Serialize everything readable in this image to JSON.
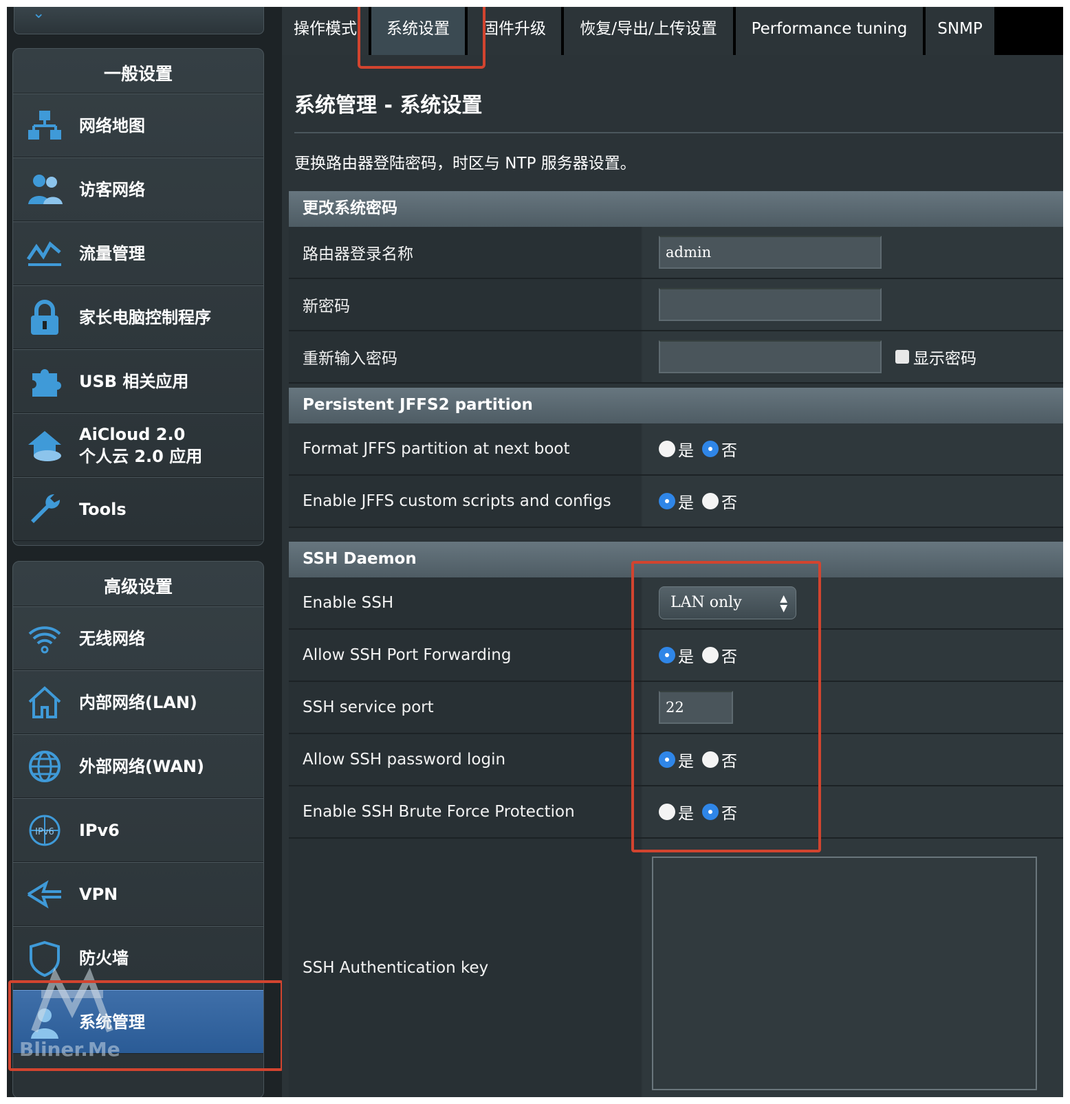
{
  "tabs": [
    {
      "label": "操作模式"
    },
    {
      "label": "系统设置"
    },
    {
      "label": "固件升级"
    },
    {
      "label": "恢复/导出/上传设置"
    },
    {
      "label": "Performance tuning"
    },
    {
      "label": "SNMP"
    }
  ],
  "sidebar": {
    "general_title": "一般设置",
    "general_items": [
      {
        "label": "网络地图",
        "icon": "network-map-icon"
      },
      {
        "label": "访客网络",
        "icon": "guest-network-icon"
      },
      {
        "label": "流量管理",
        "icon": "traffic-manager-icon"
      },
      {
        "label": "家长电脑控制程序",
        "icon": "parental-lock-icon"
      },
      {
        "label": "USB 相关应用",
        "icon": "usb-puzzle-icon"
      },
      {
        "label": "AiCloud 2.0",
        "label2": "个人云 2.0 应用",
        "icon": "aicloud-icon"
      },
      {
        "label": "Tools",
        "icon": "wrench-icon"
      }
    ],
    "advanced_title": "高级设置",
    "advanced_items": [
      {
        "label": "无线网络",
        "icon": "wifi-icon"
      },
      {
        "label": "内部网络(LAN)",
        "icon": "home-icon"
      },
      {
        "label": "外部网络(WAN)",
        "icon": "globe-icon"
      },
      {
        "label": "IPv6",
        "icon": "ipv6-globe-icon"
      },
      {
        "label": "VPN",
        "icon": "vpn-icon"
      },
      {
        "label": "防火墙",
        "icon": "firewall-shield-icon"
      },
      {
        "label": "系统管理",
        "icon": "admin-icon"
      }
    ],
    "watermark": "Bliner.Me"
  },
  "page": {
    "title": "系统管理 - 系统设置",
    "description": "更换路由器登陆密码，时区与 NTP 服务器设置。"
  },
  "sections": {
    "password": {
      "title": "更改系统密码",
      "login_name_label": "路由器登录名称",
      "login_name_value": "admin",
      "new_password_label": "新密码",
      "new_password_value": "",
      "retype_password_label": "重新输入密码",
      "retype_password_value": "",
      "show_password_label": "显示密码"
    },
    "jffs": {
      "title": "Persistent JFFS2 partition",
      "format_label": "Format JFFS partition at next boot",
      "format_value": "否",
      "scripts_label": "Enable JFFS custom scripts and configs",
      "scripts_value": "是"
    },
    "ssh": {
      "title": "SSH Daemon",
      "enable_label": "Enable SSH",
      "enable_value": "LAN only",
      "port_forwarding_label": "Allow SSH Port Forwarding",
      "port_forwarding_value": "是",
      "port_label": "SSH service port",
      "port_value": "22",
      "password_login_label": "Allow SSH password login",
      "password_login_value": "是",
      "brute_force_label": "Enable SSH Brute Force Protection",
      "brute_force_value": "否",
      "auth_key_label": "SSH Authentication key"
    }
  },
  "radio": {
    "yes": "是",
    "no": "否"
  },
  "colors": {
    "highlight": "#d2442f",
    "accent_blue": "#2f86e8",
    "active_menu": "#2a5b96"
  }
}
